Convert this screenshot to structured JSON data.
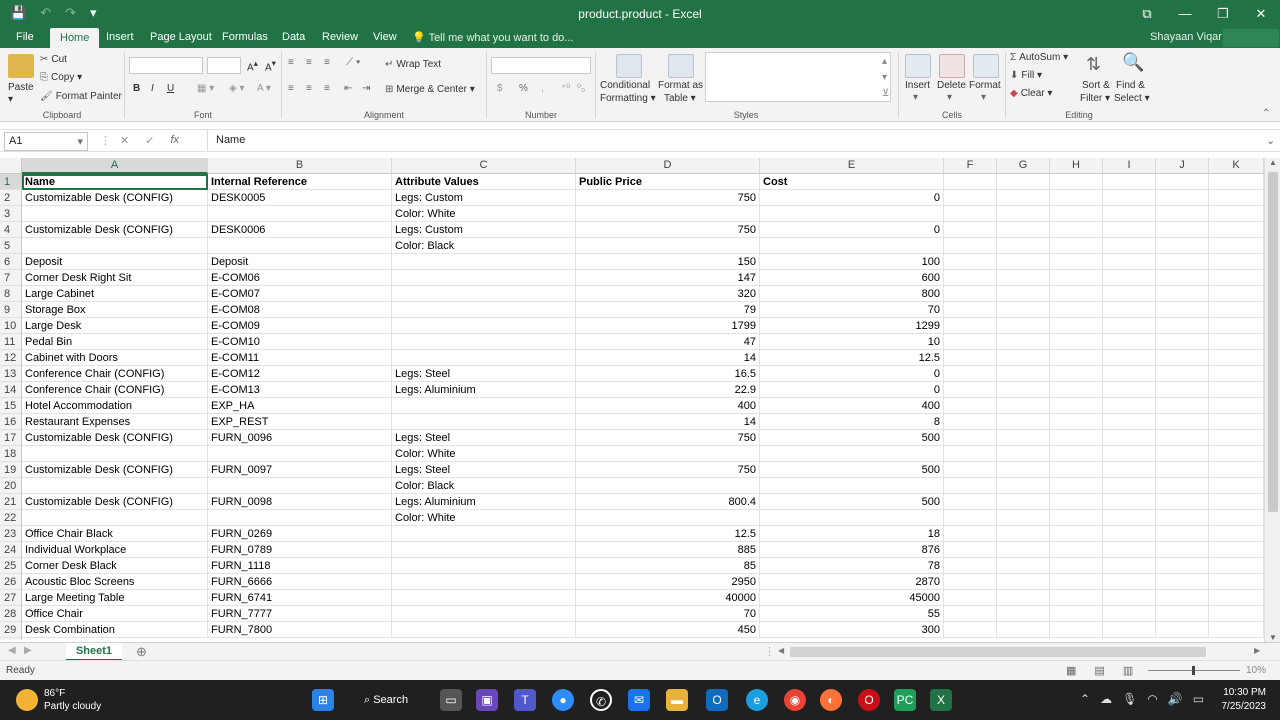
{
  "title_bar": {
    "title": "product.product - Excel",
    "save_icon": "save-icon",
    "undo_icon": "undo-icon",
    "redo_icon": "redo-icon"
  },
  "ribbon_tabs": [
    "File",
    "Home",
    "Insert",
    "Page Layout",
    "Formulas",
    "Data",
    "Review",
    "View"
  ],
  "active_tab": "Home",
  "tell_me": "Tell me what you want to do...",
  "user": "Shayaan Viqar",
  "clipboard": {
    "paste": "Paste",
    "cut": "Cut",
    "copy": "Copy",
    "format_painter": "Format Painter",
    "label": "Clipboard"
  },
  "font": {
    "label": "Font",
    "bold": "B",
    "italic": "I",
    "underline": "U"
  },
  "alignment": {
    "wrap_text": "Wrap Text",
    "merge_center": "Merge & Center",
    "label": "Alignment"
  },
  "number": {
    "label": "Number",
    "currency": "$",
    "percent": "%",
    "comma": ","
  },
  "styles": {
    "conditional": "Conditional",
    "formatting": "Formatting",
    "format_as": "Format as",
    "table": "Table",
    "label": "Styles"
  },
  "cells": {
    "insert": "Insert",
    "delete": "Delete",
    "format": "Format",
    "label": "Cells"
  },
  "editing": {
    "autosum": "AutoSum",
    "fill": "Fill",
    "clear": "Clear",
    "sort": "Sort &",
    "filter": "Filter",
    "find": "Find &",
    "select": "Select",
    "label": "Editing"
  },
  "formula_bar": {
    "name_box": "A1",
    "cancel": "✕",
    "enter": "✓",
    "fx": "fx",
    "content": "Name"
  },
  "columns": [
    "A",
    "B",
    "C",
    "D",
    "E",
    "F",
    "G",
    "H",
    "I",
    "J",
    "K"
  ],
  "rows": [
    {
      "n": "1",
      "a": "Name",
      "b": "Internal Reference",
      "c": "Attribute Values",
      "d": "Public Price",
      "e": "Cost"
    },
    {
      "n": "2",
      "a": "Customizable Desk (CONFIG)",
      "b": "DESK0005",
      "c": "Legs: Custom",
      "d": "750",
      "e": "0"
    },
    {
      "n": "3",
      "a": "",
      "b": "",
      "c": "Color: White",
      "d": "",
      "e": ""
    },
    {
      "n": "4",
      "a": "Customizable Desk (CONFIG)",
      "b": "DESK0006",
      "c": "Legs: Custom",
      "d": "750",
      "e": "0"
    },
    {
      "n": "5",
      "a": "",
      "b": "",
      "c": "Color: Black",
      "d": "",
      "e": ""
    },
    {
      "n": "6",
      "a": "Deposit",
      "b": "Deposit",
      "c": "",
      "d": "150",
      "e": "100"
    },
    {
      "n": "7",
      "a": "Corner Desk Right Sit",
      "b": "E-COM06",
      "c": "",
      "d": "147",
      "e": "600"
    },
    {
      "n": "8",
      "a": "Large Cabinet",
      "b": "E-COM07",
      "c": "",
      "d": "320",
      "e": "800"
    },
    {
      "n": "9",
      "a": "Storage Box",
      "b": "E-COM08",
      "c": "",
      "d": "79",
      "e": "70"
    },
    {
      "n": "10",
      "a": "Large Desk",
      "b": "E-COM09",
      "c": "",
      "d": "1799",
      "e": "1299"
    },
    {
      "n": "11",
      "a": "Pedal Bin",
      "b": "E-COM10",
      "c": "",
      "d": "47",
      "e": "10"
    },
    {
      "n": "12",
      "a": "Cabinet with Doors",
      "b": "E-COM11",
      "c": "",
      "d": "14",
      "e": "12.5"
    },
    {
      "n": "13",
      "a": "Conference Chair (CONFIG)",
      "b": "E-COM12",
      "c": "Legs: Steel",
      "d": "16.5",
      "e": "0"
    },
    {
      "n": "14",
      "a": "Conference Chair (CONFIG)",
      "b": "E-COM13",
      "c": "Legs: Aluminium",
      "d": "22.9",
      "e": "0"
    },
    {
      "n": "15",
      "a": "Hotel Accommodation",
      "b": "EXP_HA",
      "c": "",
      "d": "400",
      "e": "400"
    },
    {
      "n": "16",
      "a": "Restaurant Expenses",
      "b": "EXP_REST",
      "c": "",
      "d": "14",
      "e": "8"
    },
    {
      "n": "17",
      "a": "Customizable Desk (CONFIG)",
      "b": "FURN_0096",
      "c": "Legs: Steel",
      "d": "750",
      "e": "500"
    },
    {
      "n": "18",
      "a": "",
      "b": "",
      "c": "Color: White",
      "d": "",
      "e": ""
    },
    {
      "n": "19",
      "a": "Customizable Desk (CONFIG)",
      "b": "FURN_0097",
      "c": "Legs: Steel",
      "d": "750",
      "e": "500"
    },
    {
      "n": "20",
      "a": "",
      "b": "",
      "c": "Color: Black",
      "d": "",
      "e": ""
    },
    {
      "n": "21",
      "a": "Customizable Desk (CONFIG)",
      "b": "FURN_0098",
      "c": "Legs: Aluminium",
      "d": "800.4",
      "e": "500"
    },
    {
      "n": "22",
      "a": "",
      "b": "",
      "c": "Color: White",
      "d": "",
      "e": ""
    },
    {
      "n": "23",
      "a": "Office Chair Black",
      "b": "FURN_0269",
      "c": "",
      "d": "12.5",
      "e": "18"
    },
    {
      "n": "24",
      "a": "Individual Workplace",
      "b": "FURN_0789",
      "c": "",
      "d": "885",
      "e": "876"
    },
    {
      "n": "25",
      "a": "Corner Desk Black",
      "b": "FURN_1118",
      "c": "",
      "d": "85",
      "e": "78"
    },
    {
      "n": "26",
      "a": "Acoustic Bloc Screens",
      "b": "FURN_6666",
      "c": "",
      "d": "2950",
      "e": "2870"
    },
    {
      "n": "27",
      "a": "Large Meeting Table",
      "b": "FURN_6741",
      "c": "",
      "d": "40000",
      "e": "45000"
    },
    {
      "n": "28",
      "a": "Office Chair",
      "b": "FURN_7777",
      "c": "",
      "d": "70",
      "e": "55"
    },
    {
      "n": "29",
      "a": "Desk Combination",
      "b": "FURN_7800",
      "c": "",
      "d": "450",
      "e": "300"
    }
  ],
  "sheet_tab": "Sheet1",
  "status": "Ready",
  "zoom": "10%",
  "taskbar": {
    "temp": "86°F",
    "weather": "Partly cloudy",
    "search": "Search",
    "time": "10:30 PM",
    "date": "7/25/2023"
  },
  "colors": {
    "excel_green": "#217346",
    "taskbar": "#202020"
  }
}
